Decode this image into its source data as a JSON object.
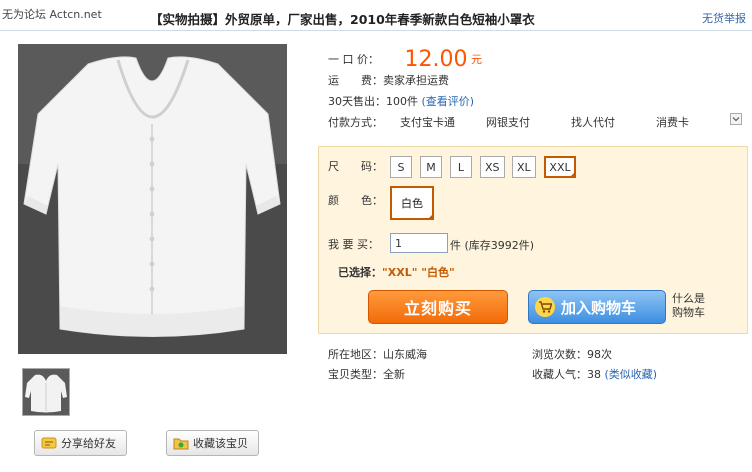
{
  "header": {
    "watermark": "无为论坛 Actcn.net",
    "title": "【实物拍摄】外贸原单，厂家出售，2010年春季新款白色短袖小罩衣",
    "report_link": "无货举报"
  },
  "summary": {
    "price_label": "一 口 价：",
    "price": "12.00",
    "price_unit": "元",
    "shipping_label": "运　　费：",
    "shipping_value": "卖家承担运费",
    "sales_label": "30天售出：",
    "sales_value": "100件",
    "reviews_link": "(查看评价)",
    "payment_label": "付款方式：",
    "payment_options": [
      "支付宝卡通",
      "网银支付",
      "找人代付",
      "消费卡"
    ]
  },
  "sku": {
    "size_label": "尺　　码：",
    "sizes": [
      "S",
      "M",
      "L",
      "XS",
      "XL",
      "XXL"
    ],
    "selected_size": "XXL",
    "color_label": "颜　　色：",
    "color_value": "白色",
    "qty_label": "我 要 买：",
    "qty_value": "1",
    "qty_unit": "件",
    "stock": "(库存3992件)",
    "selected_label": "已选择：",
    "selected_value": "\"XXL\" \"白色\""
  },
  "actions": {
    "buy_now": "立刻购买",
    "add_to_cart": "加入购物车",
    "whatis_line1": "什么是",
    "whatis_line2": "购物车"
  },
  "details": {
    "location_label": "所在地区：",
    "location_value": "山东威海",
    "views_label": "浏览次数：",
    "views_value": "98次",
    "type_label": "宝贝类型：",
    "type_value": "全新",
    "favorites_label": "收藏人气：",
    "favorites_value": "38",
    "favorites_link": "(类似收藏)"
  },
  "share": {
    "share_label": "分享给好友",
    "collect_label": "收藏该宝贝"
  },
  "colors": {
    "price": "#ff5500",
    "link": "#2966b0",
    "sku_bg": "#fff5df",
    "selected_border": "#c45a00"
  }
}
